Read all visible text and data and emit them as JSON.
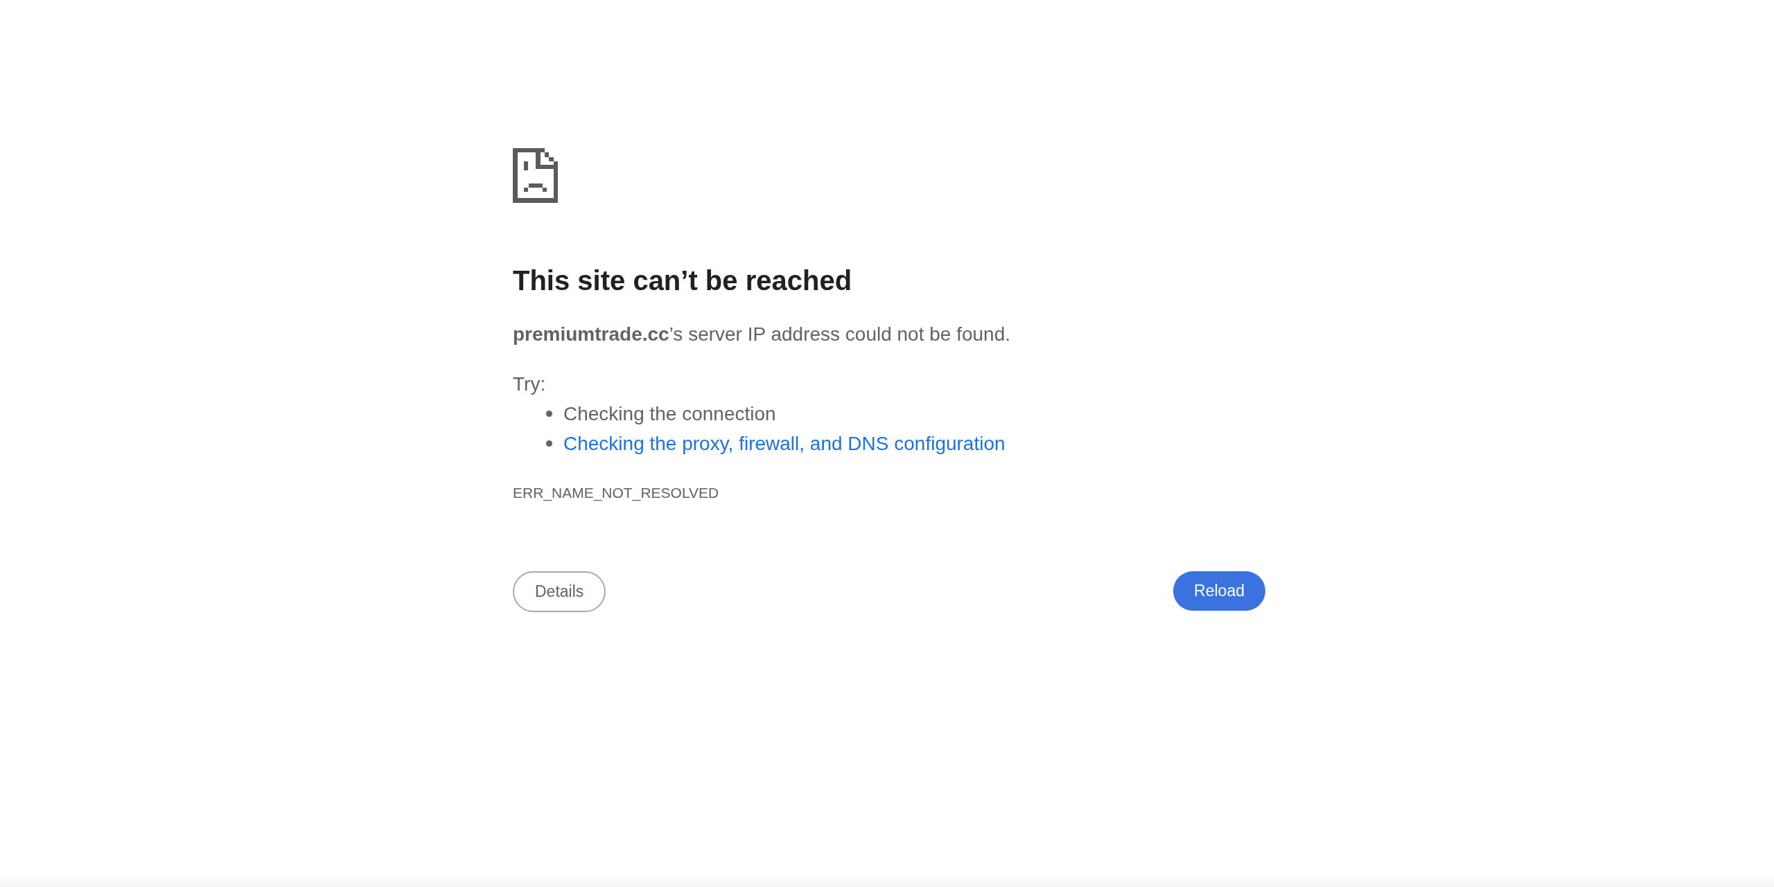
{
  "error_page": {
    "title": "This site can’t be reached",
    "message": "**premiumtrade.cc**’s server IP address could not be found.",
    "suggestions_heading": "Try:",
    "suggestions": [
      {
        "kind": "text",
        "text": "Checking the connection"
      },
      {
        "kind": "link",
        "text": "Checking the proxy, firewall, and DNS configuration"
      }
    ],
    "error_code": "ERR_NAME_NOT_RESOLVED"
  },
  "buttons": [
    {
      "kind": "secondary",
      "label": "Details"
    },
    {
      "kind": "primary",
      "label": "Reload"
    }
  ]
}
